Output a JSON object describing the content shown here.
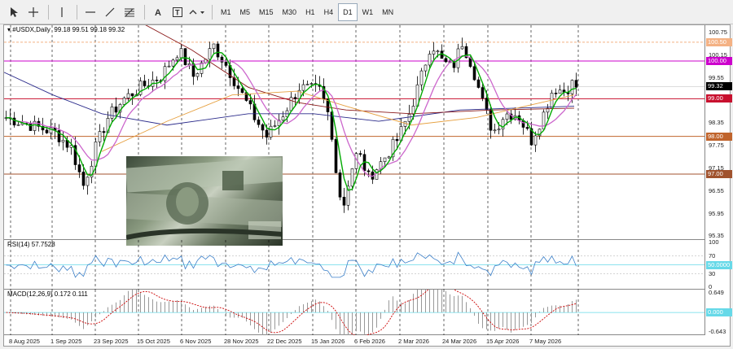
{
  "toolbar": {
    "tools": [
      "cursor-icon",
      "crosshair-icon",
      "vertical-line-icon",
      "horizontal-line-icon",
      "trendline-icon",
      "fibonacci-icon",
      "text-icon",
      "text-label-icon",
      "shapes-icon"
    ],
    "timeframes": [
      "M1",
      "M5",
      "M15",
      "M30",
      "H1",
      "H4",
      "D1",
      "W1",
      "MN"
    ],
    "active_timeframe": "D1"
  },
  "main_chart": {
    "title": "#USDX,Daily",
    "ohlc": "99.18 99.51 99.18 99.32",
    "price_labels": [
      "100.75",
      "100.15",
      "99.55",
      "98.95",
      "98.35",
      "97.75",
      "97.15",
      "96.55",
      "95.95",
      "95.35"
    ],
    "level_tags": [
      {
        "text": "100.50",
        "value": 100.5,
        "color": "#f4b183"
      },
      {
        "text": "100.00",
        "value": 100.0,
        "color": "#cc00cc"
      },
      {
        "text": "99.32",
        "value": 99.32,
        "color": "#000000"
      },
      {
        "text": "99.00",
        "value": 99.0,
        "color": "#c8102e"
      },
      {
        "text": "98.00",
        "value": 98.0,
        "color": "#c0642c"
      },
      {
        "text": "97.00",
        "value": 97.0,
        "color": "#a0522d"
      }
    ]
  },
  "rsi": {
    "title": "RSI(14) 57.7528",
    "labels": [
      "100",
      "70",
      "30",
      "0"
    ],
    "tag": {
      "text": "50.0000",
      "value": 50,
      "color": "#66d9e8"
    }
  },
  "macd": {
    "title": "MACD(12,26,9) 0.172 0.111",
    "labels": [
      "0.649",
      "-0.643"
    ],
    "tag": {
      "text": "0.000",
      "value": 0,
      "color": "#66d9e8"
    }
  },
  "dates": [
    "8 Aug 2025",
    "1 Sep 2025",
    "23 Sep 2025",
    "15 Oct 2025",
    "6 Nov 2025",
    "28 Nov 2025",
    "22 Dec 2025",
    "15 Jan 2026",
    "6 Feb 2026",
    "2 Mar 2026",
    "24 Mar 2026",
    "15 Apr 2026",
    "7 May 2026"
  ],
  "colors": {
    "bull_candle": "#333333",
    "bear_candle": "#000000",
    "ma_fast": "#00aa00",
    "ma_mid": "#cc66cc",
    "ma_slow": "#e6a040",
    "ma_long": "#8b1a1a",
    "ma_blue": "#2a2a8a",
    "rsi_line": "#3a7fc8",
    "macd_signal": "#cc0000",
    "macd_hist": "#999999"
  }
}
